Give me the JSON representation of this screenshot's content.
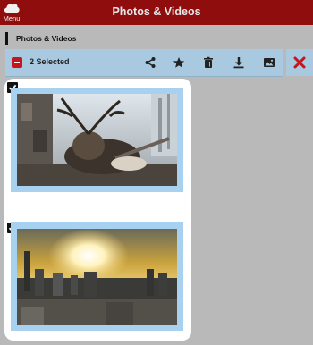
{
  "header": {
    "menu_label": "Menu",
    "title": "Photos & Videos"
  },
  "section": {
    "title": "Photos & Videos"
  },
  "selection_bar": {
    "count_label": "2 Selected",
    "actions": [
      "share-icon",
      "star-icon",
      "trash-icon",
      "download-icon",
      "image-icon"
    ],
    "close_icon": "close-icon"
  },
  "items": [
    {
      "selected": true,
      "subject": "deer-photo"
    },
    {
      "selected": true,
      "subject": "sunset-city-photo"
    }
  ],
  "colors": {
    "header_bg": "#900d0d",
    "selection_bg": "#a8c9df",
    "accent_red": "#c4161c",
    "thumb_border": "#a8d1ef"
  }
}
